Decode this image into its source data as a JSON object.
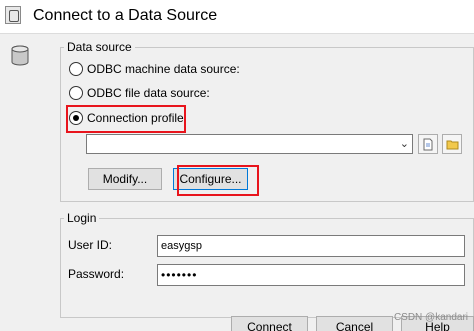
{
  "window": {
    "title": "Connect to a Data Source"
  },
  "data_source": {
    "group_label": "Data source",
    "options": [
      {
        "label": "ODBC machine data source:",
        "checked": false
      },
      {
        "label": "ODBC file data source:",
        "checked": false
      },
      {
        "label": "Connection profile:",
        "checked": true
      }
    ],
    "profile_value": "",
    "modify_label": "Modify...",
    "configure_label": "Configure..."
  },
  "login": {
    "group_label": "Login",
    "user_id_label": "User ID:",
    "user_id_value": "easygsp",
    "password_label": "Password:",
    "password_value": "•••••••"
  },
  "footer": {
    "connect_label": "Connect",
    "cancel_label": "Cancel",
    "help_label": "Help"
  },
  "watermark": "CSDN @kandari",
  "colors": {
    "highlight": "#e8141c",
    "focus": "#0078d7"
  }
}
